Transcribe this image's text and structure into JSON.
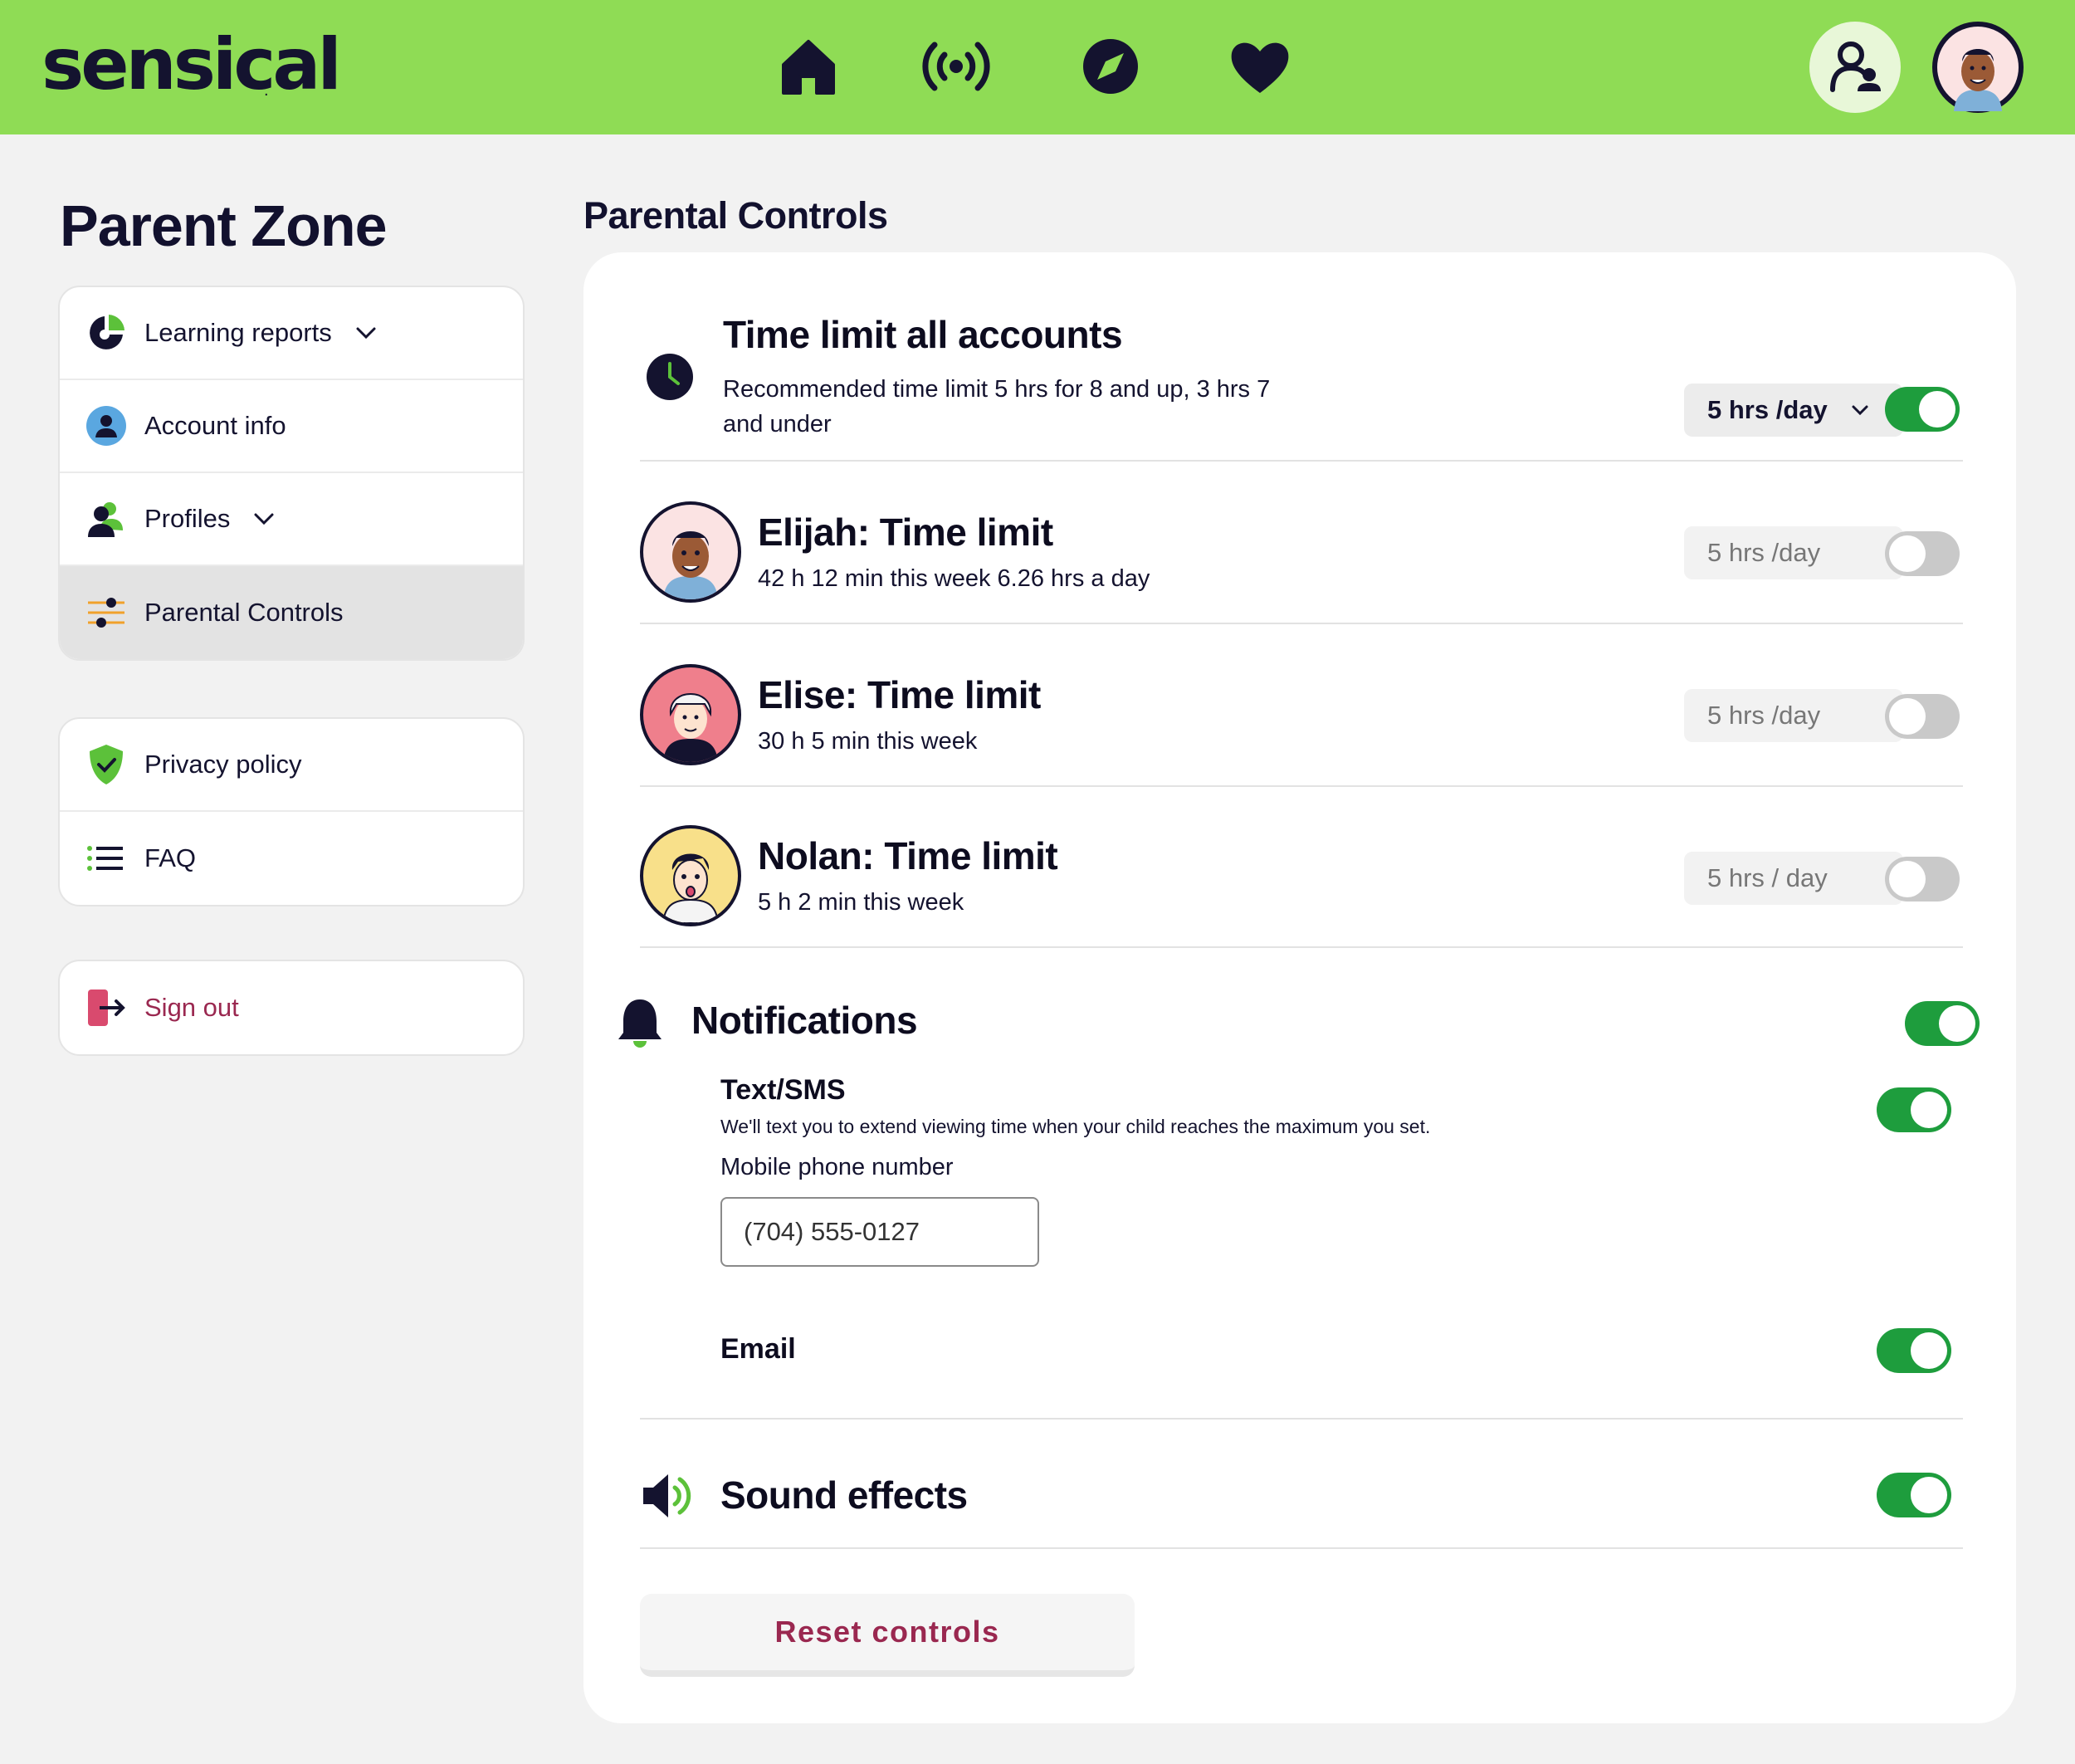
{
  "header": {
    "logo": "sensical",
    "logo_mark": ".",
    "nav": [
      "home-icon",
      "live-icon",
      "explore-icon",
      "favorites-icon"
    ]
  },
  "sidebar": {
    "title": "Parent Zone",
    "items": [
      {
        "label": "Learning reports",
        "icon": "pie-chart-icon"
      },
      {
        "label": "Account info",
        "icon": "account-icon"
      },
      {
        "label": "Profiles",
        "icon": "profiles-icon"
      },
      {
        "label": "Parental Controls",
        "icon": "sliders-icon"
      }
    ],
    "secondary": [
      {
        "label": "Privacy policy",
        "icon": "shield-check-icon"
      },
      {
        "label": "FAQ",
        "icon": "list-icon"
      }
    ],
    "signout": {
      "label": "Sign out",
      "icon": "sign-out-icon"
    }
  },
  "main": {
    "title": "Parental Controls",
    "all_accounts": {
      "title": "Time limit all accounts",
      "subtitle_line1": "Recommended time limit 5 hrs for 8 and up, 3 hrs 7",
      "subtitle_line2": "and under",
      "limit": "5 hrs /day",
      "enabled": true
    },
    "profiles": [
      {
        "title": "Elijah: Time limit",
        "stats": "42 h 12 min this week 6.26 hrs a day",
        "limit": "5 hrs /day",
        "enabled": false
      },
      {
        "title": "Elise: Time limit",
        "stats": "30 h 5 min this week",
        "limit": "5 hrs /day",
        "enabled": false
      },
      {
        "title": "Nolan: Time limit",
        "stats": "5 h 2 min this week",
        "limit": "5 hrs / day",
        "enabled": false
      }
    ],
    "notifications": {
      "title": "Notifications",
      "enabled": true,
      "sms_title": "Text/SMS",
      "sms_desc": "We'll text you to extend viewing time when your child reaches the maximum you set.",
      "sms_enabled": true,
      "phone_label": "Mobile phone number",
      "phone_value": "(704) 555-0127",
      "email_label": "Email",
      "email_enabled": true
    },
    "sound": {
      "title": "Sound effects",
      "enabled": true
    },
    "reset_label": "Reset controls"
  },
  "colors": {
    "brand_green": "#8fdc55",
    "toggle_on": "#1e9d3d",
    "accent": "#9a2850",
    "ink": "#14132f"
  }
}
